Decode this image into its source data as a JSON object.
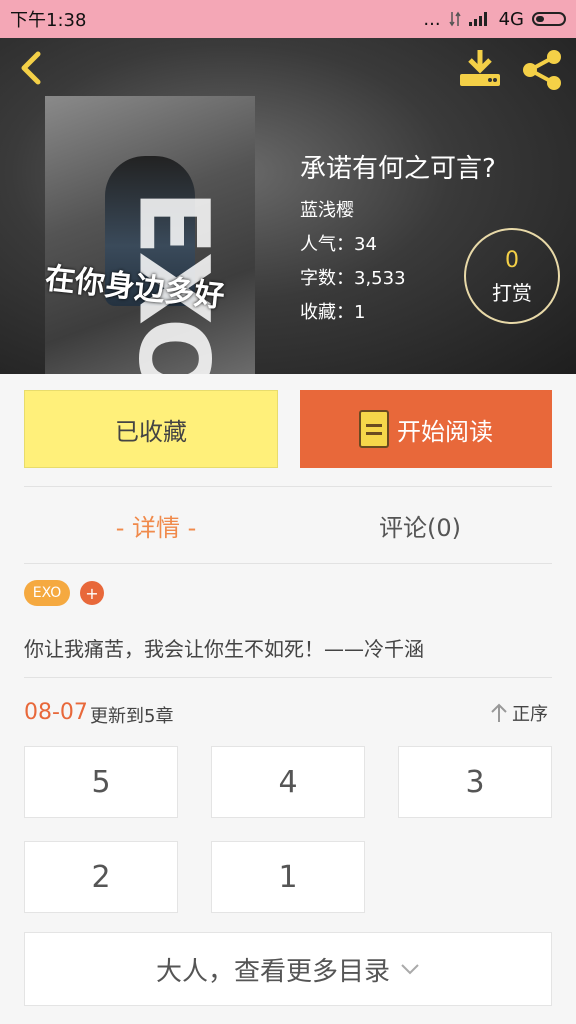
{
  "status_bar": {
    "time": "下午1:38",
    "dots": "...",
    "network": "4G"
  },
  "book": {
    "title": "承诺有何之可言?",
    "author": "蓝浅樱",
    "popularity": "人气：34",
    "word_count": "字数：3,533",
    "favorites": "收藏：1",
    "cover_overlay_text": "在你身边多好",
    "cover_logo": "EXO"
  },
  "reward": {
    "count": "0",
    "label": "打赏"
  },
  "actions": {
    "favorite_label": "已收藏",
    "read_label": "开始阅读"
  },
  "tabs": [
    {
      "label": "- 详情 -",
      "active": true
    },
    {
      "label": "评论(0)",
      "active": false
    }
  ],
  "tags": [
    {
      "label": "EXO"
    }
  ],
  "add_tag_label": "+",
  "description": "你让我痛苦，我会让你生不如死！——冷千涵",
  "update": {
    "date": "08-07",
    "text": "更新到5章",
    "sort_label": "正序"
  },
  "chapters": [
    "5",
    "4",
    "3",
    "2",
    "1"
  ],
  "more_catalog_label": "大人，查看更多目录",
  "colors": {
    "status_bar": "#f4a7b6",
    "accent": "#e8683a",
    "favorite_button": "#fff07a",
    "tag": "#f5a940",
    "reward_number": "#f4d047"
  }
}
